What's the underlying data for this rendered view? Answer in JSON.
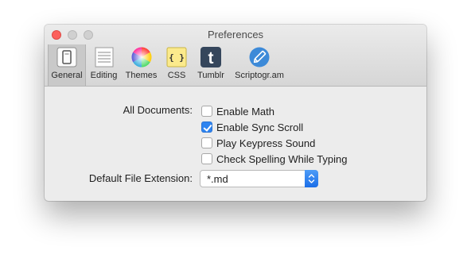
{
  "window": {
    "title": "Preferences"
  },
  "toolbar": {
    "tabs": [
      {
        "label": "General",
        "icon": "general-icon",
        "selected": true
      },
      {
        "label": "Editing",
        "icon": "editing-icon",
        "selected": false
      },
      {
        "label": "Themes",
        "icon": "themes-icon",
        "selected": false
      },
      {
        "label": "CSS",
        "icon": "css-icon",
        "icon_text": "{ }",
        "selected": false
      },
      {
        "label": "Tumblr",
        "icon": "tumblr-icon",
        "icon_text": "t",
        "selected": false
      },
      {
        "label": "Scriptogr.am",
        "icon": "scriptogram-icon",
        "selected": false
      }
    ]
  },
  "general": {
    "all_documents_label": "All Documents:",
    "options": [
      {
        "label": "Enable Math",
        "checked": false
      },
      {
        "label": "Enable Sync Scroll",
        "checked": true
      },
      {
        "label": "Play Keypress Sound",
        "checked": false
      },
      {
        "label": "Check Spelling While Typing",
        "checked": false
      }
    ],
    "default_extension_label": "Default File Extension:",
    "default_extension_value": "*.md"
  },
  "colors": {
    "accent": "#2e84f0",
    "close_button": "#fc605c"
  }
}
